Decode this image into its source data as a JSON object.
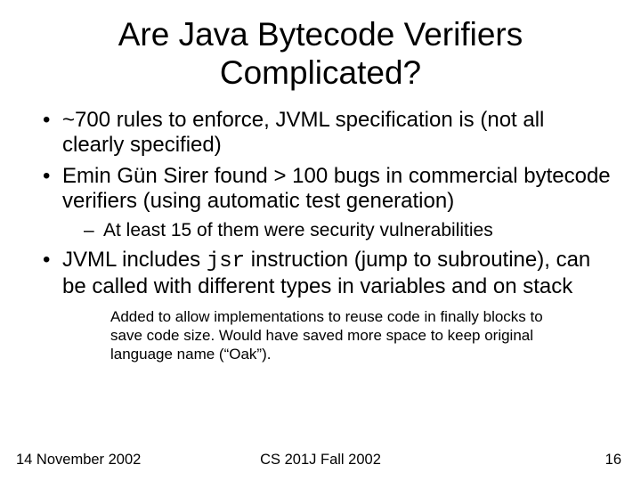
{
  "title": "Are Java Bytecode Verifiers Complicated?",
  "bullets": {
    "b1": "~700 rules to enforce, JVML specification is  (not all clearly specified)",
    "b2": "Emin Gün Sirer found > 100 bugs in commercial bytecode verifiers (using automatic test generation)",
    "b2_sub1": "At least 15 of them were security vulnerabilities",
    "b3_pre": "JVML includes ",
    "b3_code": "jsr",
    "b3_post": " instruction (jump to subroutine), can be called with different types in variables and on stack"
  },
  "note": "Added to allow implementations to reuse code in finally blocks to save code size.  Would have saved more space to keep original language name (“Oak”).",
  "footer": {
    "date": "14 November 2002",
    "course": "CS 201J Fall 2002",
    "page": "16"
  }
}
